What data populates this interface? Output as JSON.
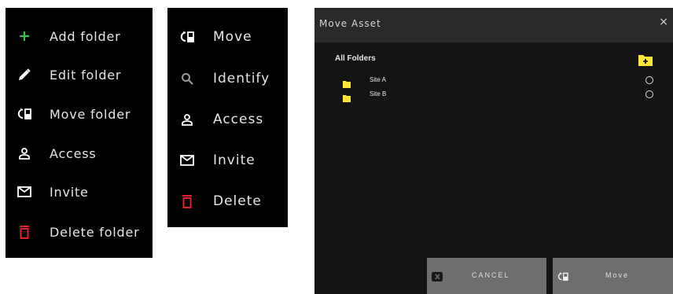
{
  "colors": {
    "menu_bg": "#000000",
    "text": "#e6e6e6",
    "add_green": "#3cc24a",
    "delete_red": "#e0202c",
    "folder_yellow": "#ffe835",
    "dialog_bg": "#141414",
    "dialog_header": "#2a2a2a",
    "button_bg": "#6d6d6d"
  },
  "menu_folder": {
    "items": [
      {
        "label": "Add folder",
        "icon": "plus-icon"
      },
      {
        "label": "Edit folder",
        "icon": "pencil-icon"
      },
      {
        "label": "Move folder",
        "icon": "move-icon"
      },
      {
        "label": "Access",
        "icon": "person-icon"
      },
      {
        "label": "Invite",
        "icon": "mail-icon"
      },
      {
        "label": "Delete folder",
        "icon": "trash-icon"
      }
    ]
  },
  "menu_asset": {
    "items": [
      {
        "label": "Move",
        "icon": "move-icon"
      },
      {
        "label": "Identify",
        "icon": "search-icon"
      },
      {
        "label": "Access",
        "icon": "person-icon"
      },
      {
        "label": "Invite",
        "icon": "mail-icon"
      },
      {
        "label": "Delete",
        "icon": "trash-icon"
      }
    ]
  },
  "dialog": {
    "title": "Move Asset",
    "close": "×",
    "root_label": "All Folders",
    "add_folder_icon": "folder-plus-icon",
    "folders": [
      {
        "name": "Site A"
      },
      {
        "name": "Site B"
      }
    ],
    "cancel_label": "CANCEL",
    "move_label": "Move"
  }
}
